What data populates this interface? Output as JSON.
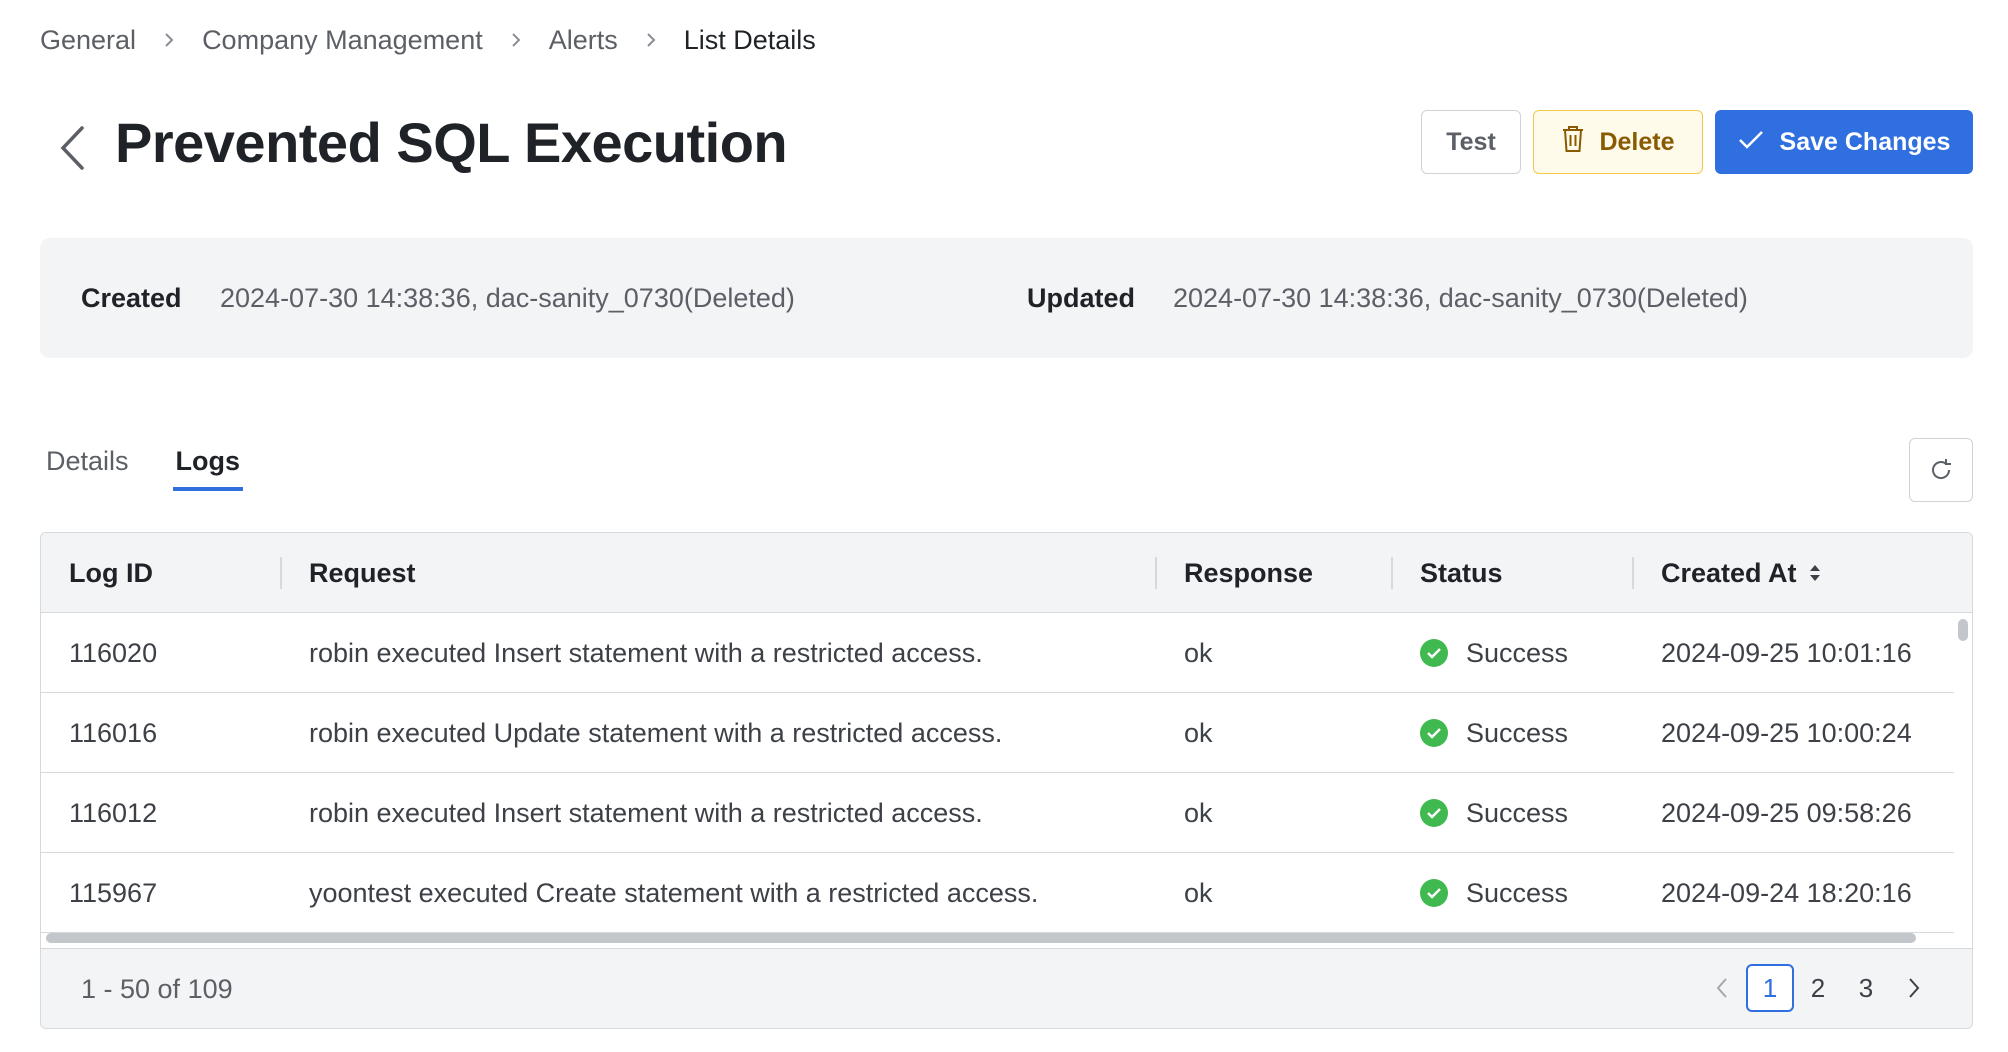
{
  "breadcrumb": {
    "items": [
      "General",
      "Company Management",
      "Alerts"
    ],
    "current": "List Details"
  },
  "header": {
    "title": "Prevented SQL Execution",
    "test_label": "Test",
    "delete_label": "Delete",
    "save_label": "Save Changes"
  },
  "meta": {
    "created_label": "Created",
    "created_value": "2024-07-30 14:38:36, dac-sanity_0730(Deleted)",
    "updated_label": "Updated",
    "updated_value": "2024-07-30 14:38:36, dac-sanity_0730(Deleted)"
  },
  "tabs": [
    {
      "label": "Details",
      "active": false
    },
    {
      "label": "Logs",
      "active": true
    }
  ],
  "table": {
    "columns": [
      "Log ID",
      "Request",
      "Response",
      "Status",
      "Created At"
    ],
    "rows": [
      {
        "log_id": "116020",
        "request": "robin executed Insert statement with a restricted access.",
        "response": "ok",
        "status": "Success",
        "created_at": "2024-09-25 10:01:16"
      },
      {
        "log_id": "116016",
        "request": "robin executed Update statement with a restricted access.",
        "response": "ok",
        "status": "Success",
        "created_at": "2024-09-25 10:00:24"
      },
      {
        "log_id": "116012",
        "request": "robin executed Insert statement with a restricted access.",
        "response": "ok",
        "status": "Success",
        "created_at": "2024-09-25 09:58:26"
      },
      {
        "log_id": "115967",
        "request": "yoontest executed Create statement with a restricted access.",
        "response": "ok",
        "status": "Success",
        "created_at": "2024-09-24 18:20:16"
      }
    ]
  },
  "footer": {
    "range_text": "1 - 50 of 109",
    "pages": [
      "1",
      "2",
      "3"
    ],
    "current_page": "1"
  },
  "colors": {
    "accent": "#2f6fdf",
    "success": "#3fb950",
    "delete_border": "#f0c94a",
    "delete_text": "#8a5a00"
  }
}
